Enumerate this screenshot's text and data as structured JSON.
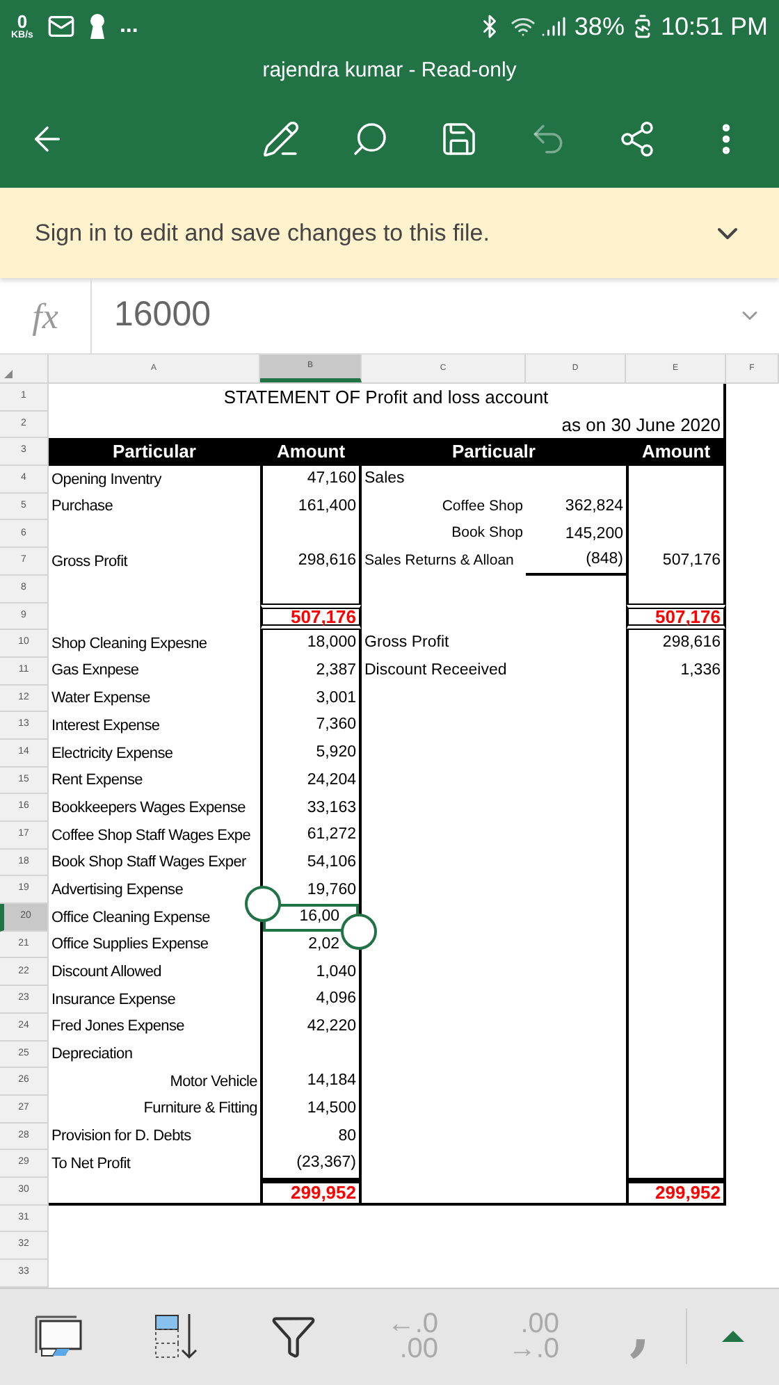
{
  "status_bar": {
    "net_speed": "0",
    "net_unit": "KB/s",
    "more": "...",
    "battery": "38%",
    "time": "10:51 PM"
  },
  "title": "rajendra kumar - Read-only",
  "toolbar": {
    "undo": {
      "disabled": true
    }
  },
  "banner": {
    "message": "Sign in to edit and save changes to this file."
  },
  "formula_bar": {
    "label": "fx",
    "value": "16000"
  },
  "columns": [
    {
      "label": "A",
      "selected": false
    },
    {
      "label": "B",
      "selected": true
    },
    {
      "label": "C",
      "selected": false
    },
    {
      "label": "D",
      "selected": false
    },
    {
      "label": "E",
      "selected": false
    },
    {
      "label": "F",
      "selected": false
    }
  ],
  "rows": [
    {
      "number": "1",
      "kind": "title",
      "selected": false,
      "cells": {
        "A": "STATEMENT OF Profit and loss account"
      }
    },
    {
      "number": "2",
      "kind": "date",
      "selected": false,
      "cells": {
        "A": "as on 30 June 2020"
      }
    },
    {
      "number": "3",
      "kind": "header",
      "selected": false,
      "cells": {
        "A": "Particular",
        "B": "Amount",
        "C": "Particualr",
        "E": "Amount"
      }
    },
    {
      "number": "4",
      "kind": "item",
      "selected": false,
      "cells": {
        "A": "Opening Inventry",
        "B": "47,160",
        "C": "Sales"
      }
    },
    {
      "number": "5",
      "kind": "detail",
      "selected": false,
      "cells": {
        "A": "Purchase",
        "B": "161,400",
        "C": "Coffee Shop",
        "D": "362,824"
      }
    },
    {
      "number": "6",
      "kind": "detail",
      "selected": false,
      "cells": {
        "C": "Book Shop",
        "D": "145,200"
      }
    },
    {
      "number": "7",
      "kind": "subtotal",
      "selected": false,
      "cells": {
        "A": "Gross Profit",
        "B": "298,616",
        "C": "Sales Returns & Alloan",
        "D": "(848)",
        "E": "507,176"
      }
    },
    {
      "number": "8",
      "kind": "spacer",
      "selected": false,
      "cells": {}
    },
    {
      "number": "9",
      "kind": "total",
      "selected": false,
      "cells": {
        "B": "507,176",
        "E": "507,176"
      }
    },
    {
      "number": "10",
      "kind": "item",
      "selected": false,
      "cells": {
        "A": "Shop Cleaning Expesne",
        "B": "18,000",
        "C": "Gross Profit",
        "E": "298,616"
      }
    },
    {
      "number": "11",
      "kind": "item",
      "selected": false,
      "cells": {
        "A": "Gas Exnpese",
        "B": "2,387",
        "C": "Discount Receeived",
        "E": "1,336"
      }
    },
    {
      "number": "12",
      "kind": "item",
      "selected": false,
      "cells": {
        "A": "Water Expense",
        "B": "3,001"
      }
    },
    {
      "number": "13",
      "kind": "item",
      "selected": false,
      "cells": {
        "A": "Interest Expense",
        "B": "7,360"
      }
    },
    {
      "number": "14",
      "kind": "item",
      "selected": false,
      "cells": {
        "A": "Electricity Expense",
        "B": "5,920"
      }
    },
    {
      "number": "15",
      "kind": "item",
      "selected": false,
      "cells": {
        "A": "Rent Expense",
        "B": "24,204"
      }
    },
    {
      "number": "16",
      "kind": "item",
      "selected": false,
      "cells": {
        "A": "Bookkeepers Wages Expense",
        "B": "33,163"
      }
    },
    {
      "number": "17",
      "kind": "item",
      "selected": false,
      "cells": {
        "A": "Coffee Shop Staff Wages Expe",
        "B": "61,272"
      }
    },
    {
      "number": "18",
      "kind": "item",
      "selected": false,
      "cells": {
        "A": "Book Shop Staff Wages Exper",
        "B": "54,106"
      }
    },
    {
      "number": "19",
      "kind": "item",
      "selected": false,
      "cells": {
        "A": "Advertising Expense",
        "B": "19,760"
      }
    },
    {
      "number": "20",
      "kind": "item",
      "selected": true,
      "cells": {
        "A": "Office Cleaning Expense",
        "B": "16,00"
      }
    },
    {
      "number": "21",
      "kind": "item",
      "selected": false,
      "cells": {
        "A": "Office Supplies Expense",
        "B": "2,02"
      }
    },
    {
      "number": "22",
      "kind": "item",
      "selected": false,
      "cells": {
        "A": "Discount Allowed",
        "B": "1,040"
      }
    },
    {
      "number": "23",
      "kind": "item",
      "selected": false,
      "cells": {
        "A": "Insurance Expense",
        "B": "4,096"
      }
    },
    {
      "number": "24",
      "kind": "item",
      "selected": false,
      "cells": {
        "A": "Fred Jones Expense",
        "B": "42,220"
      }
    },
    {
      "number": "25",
      "kind": "item",
      "selected": false,
      "cells": {
        "A": "Depreciation"
      }
    },
    {
      "number": "26",
      "kind": "subitem",
      "selected": false,
      "cells": {
        "A": "Motor Vehicle",
        "B": "14,184"
      }
    },
    {
      "number": "27",
      "kind": "subitem",
      "selected": false,
      "cells": {
        "A": "Furniture & Fitting",
        "B": "14,500"
      }
    },
    {
      "number": "28",
      "kind": "item",
      "selected": false,
      "cells": {
        "A": "Provision for D. Debts",
        "B": "80"
      }
    },
    {
      "number": "29",
      "kind": "item",
      "selected": false,
      "cells": {
        "A": "To Net Profit",
        "B": "(23,367)"
      }
    },
    {
      "number": "30",
      "kind": "total",
      "selected": false,
      "cells": {
        "B": "299,952",
        "E": "299,952"
      }
    },
    {
      "number": "31",
      "kind": "blank",
      "selected": false,
      "cells": {}
    },
    {
      "number": "32",
      "kind": "blank",
      "selected": false,
      "cells": {}
    },
    {
      "number": "33",
      "kind": "blank",
      "selected": false,
      "cells": {}
    }
  ],
  "bottom_toolbar": {
    "decrease_decimal": {
      "lines": [
        "←.0",
        ".00"
      ],
      "disabled": true
    },
    "increase_decimal": {
      "lines": [
        ".00",
        "→.0"
      ],
      "disabled": true
    },
    "comma_style": ","
  }
}
